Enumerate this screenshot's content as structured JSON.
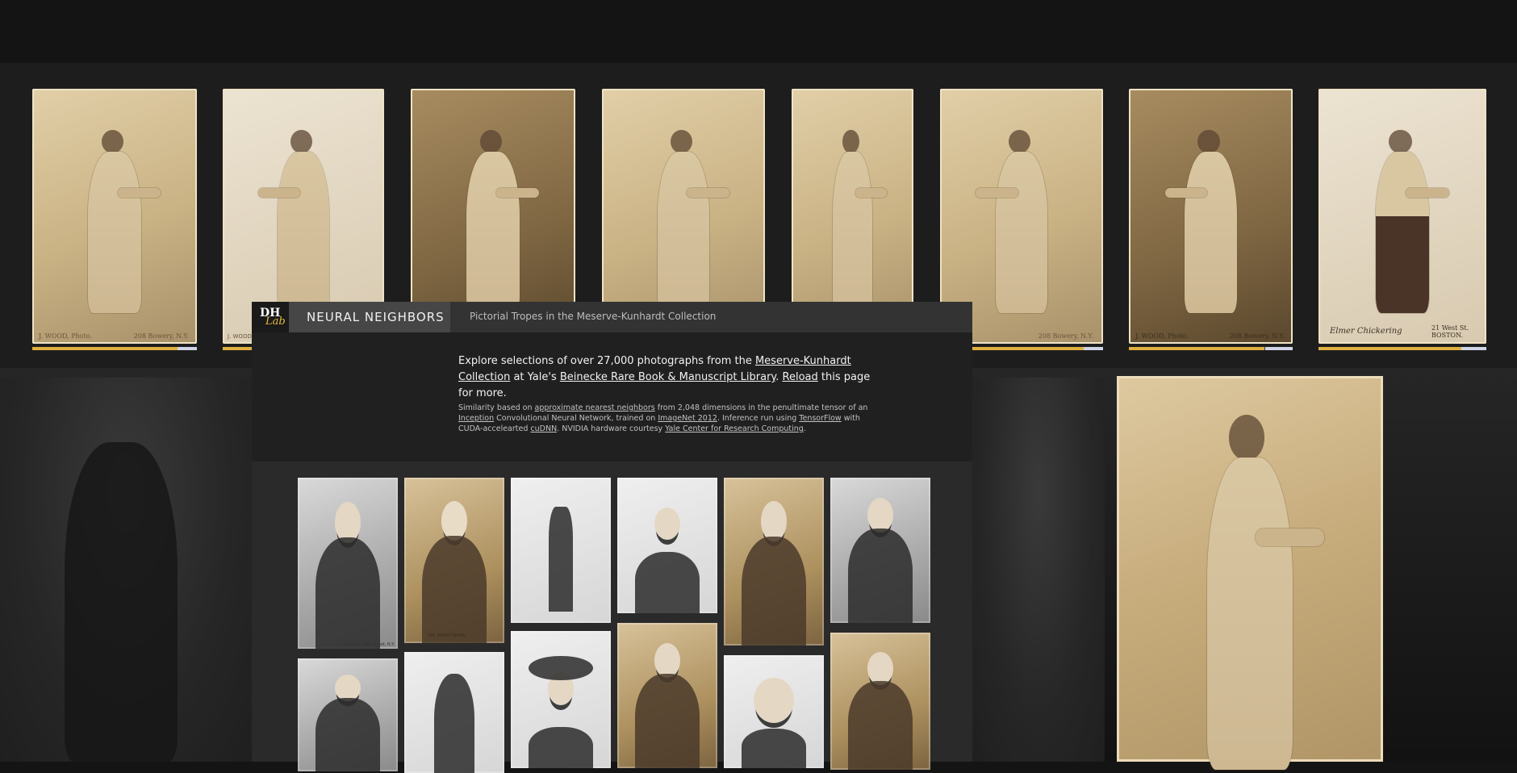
{
  "header": {
    "title": "NEURAL NEIGHBORS",
    "subtitle": "Pictorial Tropes in the Meserve-Kunhardt Collection",
    "logo_top": "DH",
    "logo_bottom": "Lab"
  },
  "intro": {
    "text_1": "Explore selections of over 27,000 photographs from the ",
    "link_collection": "Meserve-Kunhardt Collection",
    "text_2": " at Yale's ",
    "link_library": "Beinecke Rare Book & Manuscript Library",
    "text_3": ". ",
    "link_reload": "Reload",
    "text_4": " this page for more."
  },
  "note": {
    "t1": "Similarity based on ",
    "l1": "approximate nearest neighbors",
    "t2": " from 2,048 dimensions in the penultimate tensor of an ",
    "l2": "Inception",
    "t3": " Convolutional Neural Network, trained on ",
    "l3": "ImageNet 2012",
    "t4": ". Inference run using ",
    "l4": "TensorFlow",
    "t5": " with CUDA-accelearted ",
    "l5": "cuDNN",
    "t6": ". NVIDIA hardware courtesy ",
    "l6": "Yale Center for Research Computing",
    "t7": "."
  },
  "strip_photos": [
    {
      "caption_left": "J. WOOD, Photo.",
      "caption_right": "208 Bowery, N.Y.",
      "progress": 0.88
    },
    {
      "caption_left": "J. WOOD",
      "caption_right": "",
      "progress": 1.0
    },
    {
      "caption_left": "",
      "caption_right": "",
      "progress": 1.0
    },
    {
      "caption_left": "",
      "caption_right": "",
      "progress": 1.0
    },
    {
      "caption_left": "",
      "caption_right": "",
      "progress": 1.0
    },
    {
      "caption_left": "",
      "caption_right": "208 Bowery, N.Y.",
      "progress": 0.85
    },
    {
      "caption_left": "J. WOOD, Photo.",
      "caption_right": "208 Bowery, N.Y.",
      "progress": 0.83
    },
    {
      "caption_left": "Elmer Chickering",
      "caption_right": "21 West St. BOSTON.",
      "progress": 0.85
    }
  ],
  "grid_captions": {
    "c1": "MR. HENRY IRVING",
    "c2": "26 West 14th Street, N.Y."
  },
  "colors": {
    "accent": "#e0b03f",
    "panel": "#2a2a2a",
    "header": "#333333"
  }
}
